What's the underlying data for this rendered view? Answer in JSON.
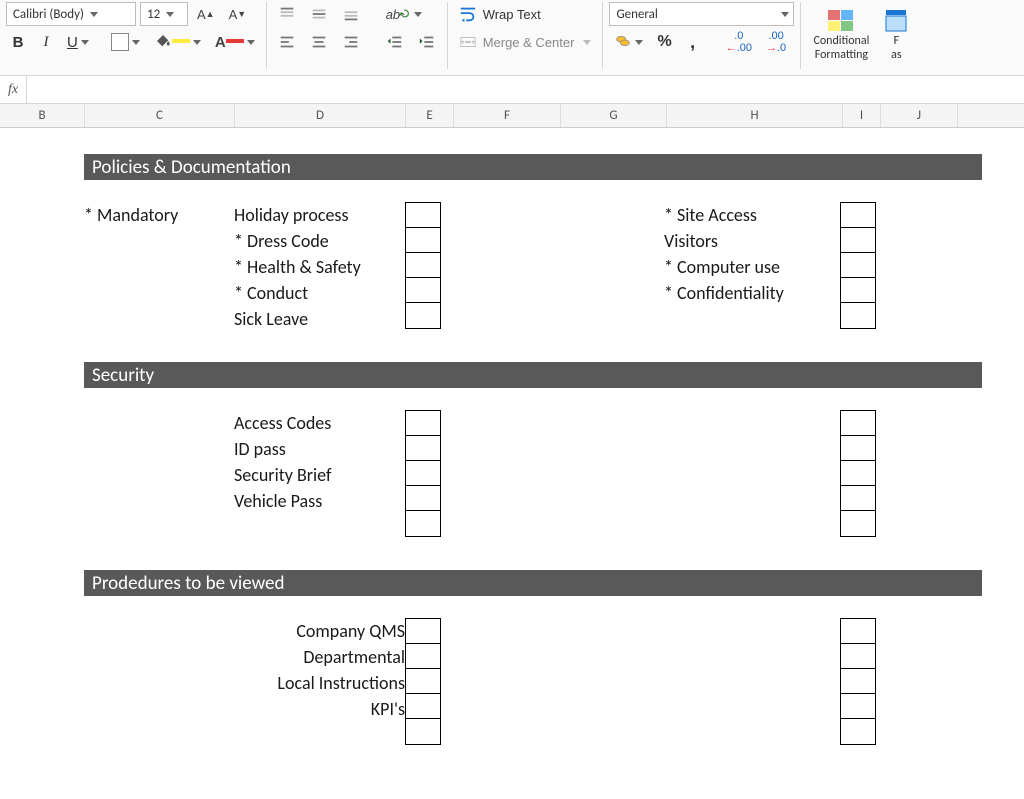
{
  "ribbon": {
    "font_name": "Calibri (Body)",
    "font_size": "12",
    "wrap_text": "Wrap Text",
    "merge_center": "Merge & Center",
    "number_format": "General",
    "conditional_formatting": "Conditional\nFormatting",
    "format_as": "F\nas"
  },
  "columns": [
    "B",
    "C",
    "D",
    "E",
    "F",
    "G",
    "H",
    "I",
    "J"
  ],
  "sections": {
    "policies": {
      "title": "Policies & Documentation",
      "left_label": "* Mandatory",
      "left_items": [
        "Holiday process",
        "* Dress Code",
        "* Health & Safety",
        "* Conduct",
        "Sick Leave"
      ],
      "right_items": [
        "* Site Access",
        "Visitors",
        "* Computer use",
        "* Confidentiality",
        ""
      ]
    },
    "security": {
      "title": "Security",
      "left_items": [
        "Access Codes",
        "ID pass",
        "Security Brief",
        "Vehicle Pass",
        ""
      ],
      "right_items": [
        "",
        "",
        "",
        "",
        ""
      ]
    },
    "procedures": {
      "title": "Prodedures to be viewed",
      "left_items": [
        "Company QMS",
        "Departmental",
        "Local Instructions",
        "KPI's",
        ""
      ],
      "right_items": [
        "",
        "",
        "",
        "",
        ""
      ]
    }
  }
}
